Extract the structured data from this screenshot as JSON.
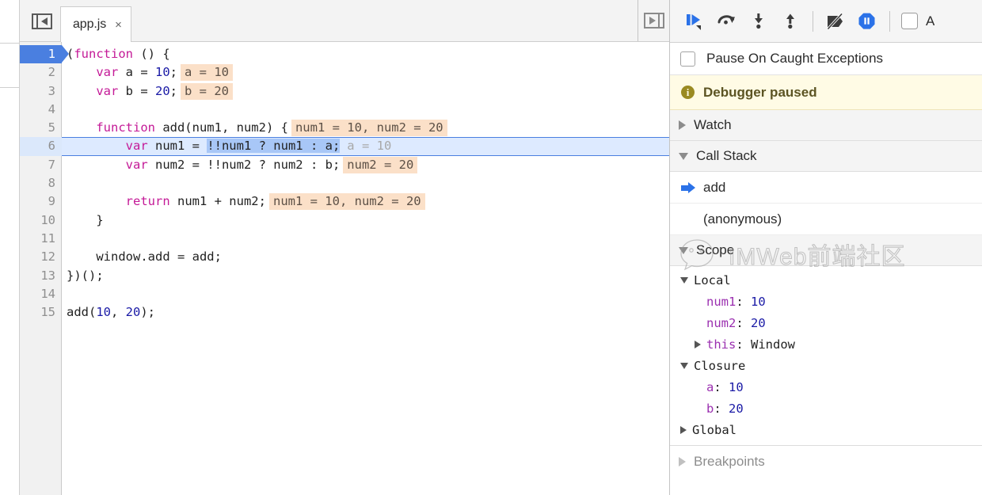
{
  "window": {
    "app": "Chrome DevTools Sources Panel"
  },
  "navigator_toggle": {
    "icon": "show-navigator-icon"
  },
  "editor": {
    "tab": {
      "label": "app.js",
      "close_label": "×"
    },
    "right_toggle_icon": "show-debugger-sidebar-icon",
    "paused_line": 6,
    "breakpoint_line": 1,
    "lines": [
      {
        "n": "1",
        "tokens": [
          {
            "t": "plain",
            "v": "("
          },
          {
            "t": "kw",
            "v": "function"
          },
          {
            "t": "plain",
            "v": " () {"
          }
        ],
        "hint": null
      },
      {
        "n": "2",
        "tokens": [
          {
            "t": "plain",
            "v": "    "
          },
          {
            "t": "kw",
            "v": "var"
          },
          {
            "t": "plain",
            "v": " a = "
          },
          {
            "t": "num",
            "v": "10"
          },
          {
            "t": "plain",
            "v": ";"
          }
        ],
        "hint": "a = 10"
      },
      {
        "n": "3",
        "tokens": [
          {
            "t": "plain",
            "v": "    "
          },
          {
            "t": "kw",
            "v": "var"
          },
          {
            "t": "plain",
            "v": " b = "
          },
          {
            "t": "num",
            "v": "20"
          },
          {
            "t": "plain",
            "v": ";"
          }
        ],
        "hint": "b = 20"
      },
      {
        "n": "4",
        "tokens": [],
        "hint": null
      },
      {
        "n": "5",
        "tokens": [
          {
            "t": "plain",
            "v": "    "
          },
          {
            "t": "kw",
            "v": "function"
          },
          {
            "t": "plain",
            "v": " add(num1, num2) {"
          }
        ],
        "hint": "num1 = 10, num2 = 20"
      },
      {
        "n": "6",
        "tokens": [
          {
            "t": "plain",
            "v": "        "
          },
          {
            "t": "kw",
            "v": "var"
          },
          {
            "t": "plain",
            "v": " num1 = "
          },
          {
            "t": "sel",
            "v": "!!num1 ? num1 : a;"
          }
        ],
        "hint": "a = 10",
        "hint_muted": true
      },
      {
        "n": "7",
        "tokens": [
          {
            "t": "plain",
            "v": "        "
          },
          {
            "t": "kw",
            "v": "var"
          },
          {
            "t": "plain",
            "v": " num2 = !!num2 ? num2 : b;"
          }
        ],
        "hint": "num2 = 20"
      },
      {
        "n": "8",
        "tokens": [],
        "hint": null
      },
      {
        "n": "9",
        "tokens": [
          {
            "t": "plain",
            "v": "        "
          },
          {
            "t": "kw",
            "v": "return"
          },
          {
            "t": "plain",
            "v": " num1 + num2;"
          }
        ],
        "hint": "num1 = 10, num2 = 20"
      },
      {
        "n": "10",
        "tokens": [
          {
            "t": "plain",
            "v": "    }"
          }
        ],
        "hint": null
      },
      {
        "n": "11",
        "tokens": [],
        "hint": null
      },
      {
        "n": "12",
        "tokens": [
          {
            "t": "plain",
            "v": "    window.add = add;"
          }
        ],
        "hint": null
      },
      {
        "n": "13",
        "tokens": [
          {
            "t": "plain",
            "v": "})();"
          }
        ],
        "hint": null
      },
      {
        "n": "14",
        "tokens": [],
        "hint": null
      },
      {
        "n": "15",
        "tokens": [
          {
            "t": "plain",
            "v": "add("
          },
          {
            "t": "num",
            "v": "10"
          },
          {
            "t": "plain",
            "v": ", "
          },
          {
            "t": "num",
            "v": "20"
          },
          {
            "t": "plain",
            "v": ");"
          }
        ],
        "hint": null
      }
    ]
  },
  "debugger": {
    "toolbar": {
      "buttons": [
        {
          "icon": "resume-script-execution-icon",
          "title": "Resume script execution"
        },
        {
          "icon": "step-over-next-function-call-icon",
          "title": "Step over next function call"
        },
        {
          "icon": "step-into-next-function-call-icon",
          "title": "Step into next function call"
        },
        {
          "icon": "step-out-of-current-function-icon",
          "title": "Step out of current function"
        },
        {
          "icon": "deactivate-breakpoints-icon",
          "title": "Deactivate breakpoints"
        },
        {
          "icon": "pause-on-exceptions-icon",
          "title": "Pause on exceptions"
        }
      ],
      "async_checkbox": {
        "label": "A",
        "checked": false,
        "icon": "checkbox-unchecked-icon"
      }
    },
    "pause_on_caught": {
      "label": "Pause On Caught Exceptions",
      "checked": false,
      "icon": "checkbox-unchecked-icon"
    },
    "banner": {
      "icon": "info-icon",
      "text": "Debugger paused"
    },
    "sections": [
      {
        "id": "watch",
        "title": "Watch",
        "expanded": false
      },
      {
        "id": "call-stack",
        "title": "Call Stack",
        "expanded": true
      },
      {
        "id": "scope",
        "title": "Scope",
        "expanded": true
      },
      {
        "id": "breakpoints",
        "title": "Breakpoints",
        "expanded": false
      }
    ],
    "call_stack": [
      {
        "name": "add",
        "active": true
      },
      {
        "name": "(anonymous)",
        "active": false
      }
    ],
    "scope": [
      {
        "group": "Local",
        "expanded": true,
        "props": [
          {
            "key": "num1",
            "sep": ": ",
            "value": "10",
            "kind": "number",
            "expandable": false
          },
          {
            "key": "num2",
            "sep": ": ",
            "value": "20",
            "kind": "number",
            "expandable": false
          },
          {
            "key": "this",
            "sep": ": ",
            "value": "Window",
            "kind": "object",
            "expandable": true
          }
        ]
      },
      {
        "group": "Closure",
        "expanded": true,
        "props": [
          {
            "key": "a",
            "sep": ": ",
            "value": "10",
            "kind": "number",
            "expandable": false
          },
          {
            "key": "b",
            "sep": ": ",
            "value": "20",
            "kind": "number",
            "expandable": false
          }
        ]
      },
      {
        "group": "Global",
        "expanded": false,
        "props": []
      }
    ]
  },
  "watermark": {
    "text": "IMWeb前端社区",
    "icon": "wechat-logo-icon"
  },
  "colors": {
    "accent_blue": "#2b72e8",
    "breakpoint_blue": "#4a7fe0",
    "paused_line_bg": "#ddeaff",
    "selection_blue": "#a8c7f7",
    "inline_hint_bg": "#fbe0c8",
    "keyword_magenta": "#c41a97",
    "number_blue": "#1a1aa6",
    "prop_key_purple": "#9b30b0",
    "banner_bg": "#fffbe5",
    "banner_text": "#5c5423"
  }
}
